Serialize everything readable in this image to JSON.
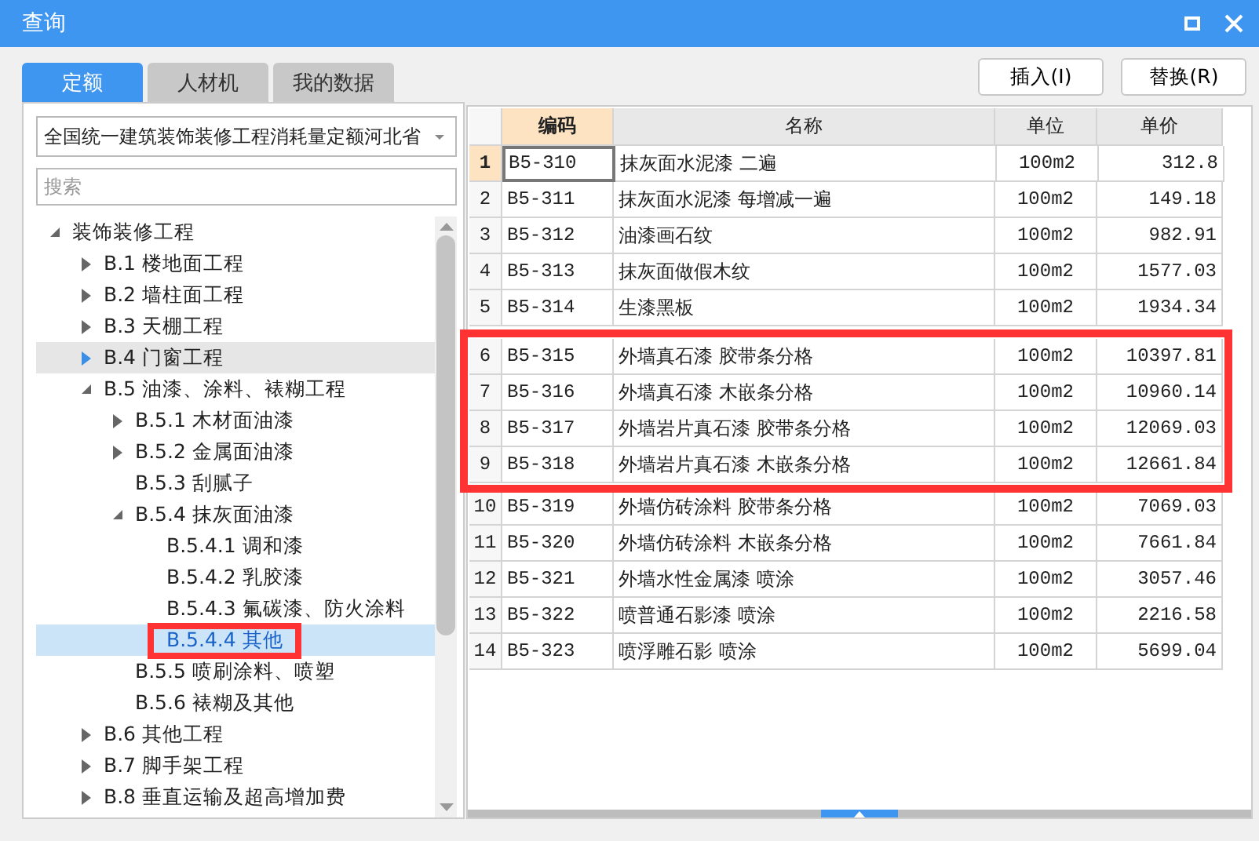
{
  "window": {
    "title": "查询"
  },
  "tabs": [
    {
      "label": "定额",
      "selected": true
    },
    {
      "label": "人材机",
      "selected": false
    },
    {
      "label": "我的数据",
      "selected": false
    }
  ],
  "library_select": {
    "value": "全国统一建筑装饰装修工程消耗量定额河北省"
  },
  "search": {
    "placeholder": "搜索"
  },
  "tree": [
    {
      "label": "装饰装修工程",
      "expanded": true,
      "selected": false,
      "hovered": false,
      "marked": false,
      "children": [
        {
          "label": "B.1 楼地面工程",
          "expanded": false,
          "selected": false,
          "hovered": false,
          "marked": false
        },
        {
          "label": "B.2 墙柱面工程",
          "expanded": false,
          "selected": false,
          "hovered": false,
          "marked": false
        },
        {
          "label": "B.3 天棚工程",
          "expanded": false,
          "selected": false,
          "hovered": false,
          "marked": false
        },
        {
          "label": "B.4 门窗工程",
          "expanded": false,
          "selected": false,
          "hovered": true,
          "marked": false
        },
        {
          "label": "B.5 油漆、涂料、裱糊工程",
          "expanded": true,
          "selected": false,
          "hovered": false,
          "marked": false,
          "children": [
            {
              "label": "B.5.1 木材面油漆",
              "expanded": false,
              "selected": false,
              "hovered": false,
              "marked": false
            },
            {
              "label": "B.5.2 金属面油漆",
              "expanded": false,
              "selected": false,
              "hovered": false,
              "marked": false
            },
            {
              "label": "B.5.3 刮腻子",
              "selected": false,
              "hovered": false,
              "marked": false
            },
            {
              "label": "B.5.4 抹灰面油漆",
              "expanded": true,
              "selected": false,
              "hovered": false,
              "marked": false,
              "children": [
                {
                  "label": "B.5.4.1 调和漆",
                  "selected": false,
                  "hovered": false,
                  "marked": false
                },
                {
                  "label": "B.5.4.2 乳胶漆",
                  "selected": false,
                  "hovered": false,
                  "marked": false
                },
                {
                  "label": "B.5.4.3 氟碳漆、防火涂料",
                  "selected": false,
                  "hovered": false,
                  "marked": false
                },
                {
                  "label": "B.5.4.4 其他",
                  "selected": true,
                  "hovered": false,
                  "marked": true
                }
              ]
            },
            {
              "label": "B.5.5 喷刷涂料、喷塑",
              "selected": false,
              "hovered": false,
              "marked": false
            },
            {
              "label": "B.5.6 裱糊及其他",
              "selected": false,
              "hovered": false,
              "marked": false
            }
          ]
        },
        {
          "label": "B.6 其他工程",
          "expanded": false,
          "selected": false,
          "hovered": false,
          "marked": false
        },
        {
          "label": "B.7 脚手架工程",
          "expanded": false,
          "selected": false,
          "hovered": false,
          "marked": false
        },
        {
          "label": "B.8 垂直运输及超高增加费",
          "expanded": false,
          "selected": false,
          "hovered": false,
          "marked": false
        }
      ]
    }
  ],
  "buttons": [
    {
      "label": "插入(I)"
    },
    {
      "label": "替换(R)"
    }
  ],
  "table": {
    "columns": [
      {
        "label": "编码",
        "selected": true
      },
      {
        "label": "名称",
        "selected": false
      },
      {
        "label": "单位",
        "selected": false
      },
      {
        "label": "单价",
        "selected": false
      }
    ],
    "rows": [
      {
        "index": "1",
        "selected": true,
        "marked": false,
        "cells": [
          "B5-310",
          "抹灰面水泥漆 二遍",
          "100m2",
          "312.8"
        ]
      },
      {
        "index": "2",
        "selected": false,
        "marked": false,
        "cells": [
          "B5-311",
          "抹灰面水泥漆 每增减一遍",
          "100m2",
          "149.18"
        ]
      },
      {
        "index": "3",
        "selected": false,
        "marked": false,
        "cells": [
          "B5-312",
          "油漆画石纹",
          "100m2",
          "982.91"
        ]
      },
      {
        "index": "4",
        "selected": false,
        "marked": false,
        "cells": [
          "B5-313",
          "抹灰面做假木纹",
          "100m2",
          "1577.03"
        ]
      },
      {
        "index": "5",
        "selected": false,
        "marked": false,
        "cells": [
          "B5-314",
          "生漆黑板",
          "100m2",
          "1934.34"
        ]
      },
      {
        "index": "6",
        "selected": false,
        "marked": true,
        "cells": [
          "B5-315",
          "外墙真石漆 胶带条分格",
          "100m2",
          "10397.81"
        ]
      },
      {
        "index": "7",
        "selected": false,
        "marked": true,
        "cells": [
          "B5-316",
          "外墙真石漆 木嵌条分格",
          "100m2",
          "10960.14"
        ]
      },
      {
        "index": "8",
        "selected": false,
        "marked": true,
        "cells": [
          "B5-317",
          "外墙岩片真石漆 胶带条分格",
          "100m2",
          "12069.03"
        ]
      },
      {
        "index": "9",
        "selected": false,
        "marked": true,
        "cells": [
          "B5-318",
          "外墙岩片真石漆 木嵌条分格",
          "100m2",
          "12661.84"
        ]
      },
      {
        "index": "10",
        "selected": false,
        "marked": false,
        "cells": [
          "B5-319",
          "外墙仿砖涂料 胶带条分格",
          "100m2",
          "7069.03"
        ]
      },
      {
        "index": "11",
        "selected": false,
        "marked": false,
        "cells": [
          "B5-320",
          "外墙仿砖涂料 木嵌条分格",
          "100m2",
          "7661.84"
        ]
      },
      {
        "index": "12",
        "selected": false,
        "marked": false,
        "cells": [
          "B5-321",
          "外墙水性金属漆 喷涂",
          "100m2",
          "3057.46"
        ]
      },
      {
        "index": "13",
        "selected": false,
        "marked": false,
        "cells": [
          "B5-322",
          "喷普通石影漆 喷涂",
          "100m2",
          "2216.58"
        ]
      },
      {
        "index": "14",
        "selected": false,
        "marked": false,
        "cells": [
          "B5-323",
          "喷浮雕石影 喷涂",
          "100m2",
          "5699.04"
        ]
      }
    ]
  }
}
